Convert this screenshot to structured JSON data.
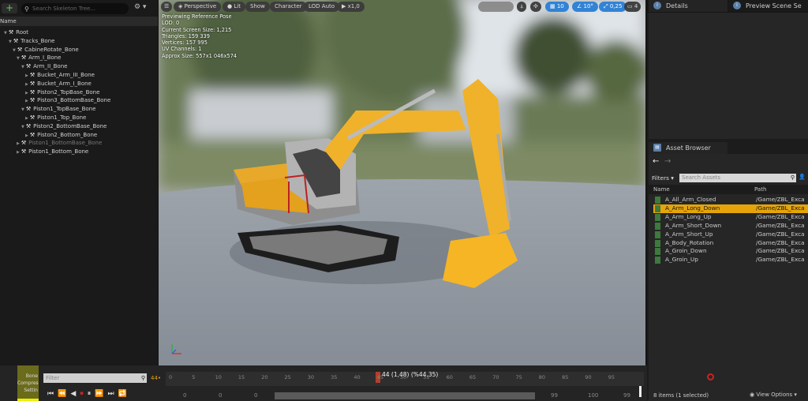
{
  "skeleton_tree": {
    "search_placeholder": "Search Skeleton Tree...",
    "add_label": "+",
    "column_name": "Name",
    "bones": [
      {
        "label": "Root"
      },
      {
        "label": "Tracks_Bone"
      },
      {
        "label": "CabineRotate_Bone"
      },
      {
        "label": "Arm_I_Bone"
      },
      {
        "label": "Arm_II_Bone"
      },
      {
        "label": "Bucket_Arm_III_Bone"
      },
      {
        "label": "Bucket_Arm_I_Bone"
      },
      {
        "label": "Piston2_TopBase_Bone"
      },
      {
        "label": "Piston3_BottomBase_Bone"
      },
      {
        "label": "Piston1_TopBase_Bone"
      },
      {
        "label": "Piston1_Top_Bone"
      },
      {
        "label": "Piston2_BottomBase_Bone"
      },
      {
        "label": "Piston2_Bottom_Bone"
      },
      {
        "label": "Piston1_BottomBase_Bone"
      },
      {
        "label": "Piston1_Bottom_Bone"
      }
    ]
  },
  "viewport": {
    "toolbar": {
      "perspective": "Perspective",
      "lit": "Lit",
      "show": "Show",
      "character": "Character",
      "lod": "LOD Auto",
      "play": "x1,0",
      "grid_snap": "10",
      "rot_snap": "10°",
      "scale_snap": "0,25",
      "camera_speed": "4"
    },
    "stats": [
      "Previewing Reference Pose",
      "LOD: 0",
      "Current Screen Size: 1,215",
      "Triangles: 159 339",
      "Vertices: 157 995",
      "UV Channels: 1",
      "Approx Size: 557x1 046x574"
    ]
  },
  "right_panel": {
    "tabs": [
      {
        "label": "Details"
      },
      {
        "label": "Preview Scene Se"
      }
    ],
    "asset_browser": {
      "tab_label": "Asset Browser",
      "filters_label": "Filters",
      "search_placeholder": "Search Assets",
      "col_name": "Name",
      "col_path": "Path",
      "assets": [
        {
          "name": "A_All_Arm_Closed",
          "path": "/Game/ZBL_Exca"
        },
        {
          "name": "A_Arm_Long_Down",
          "path": "/Game/ZBL_Exca",
          "selected": true
        },
        {
          "name": "A_Arm_Long_Up",
          "path": "/Game/ZBL_Exca"
        },
        {
          "name": "A_Arm_Short_Down",
          "path": "/Game/ZBL_Exca"
        },
        {
          "name": "A_Arm_Short_Up",
          "path": "/Game/ZBL_Exca"
        },
        {
          "name": "A_Body_Rotation",
          "path": "/Game/ZBL_Exca"
        },
        {
          "name": "A_Groin_Down",
          "path": "/Game/ZBL_Exca"
        },
        {
          "name": "A_Groin_Up",
          "path": "/Game/ZBL_Exca"
        }
      ],
      "status": "8 items (1 selected)",
      "view_options": "View Options"
    }
  },
  "timeline": {
    "side_label": "Bone Compres Settin",
    "filter_placeholder": "Filter",
    "frame_label": "44",
    "playhead_label": "44 (1,48) (%44,35)",
    "ticks": [
      "0",
      "5",
      "10",
      "15",
      "20",
      "25",
      "30",
      "35",
      "40",
      "45",
      "50",
      "55",
      "60",
      "65",
      "70",
      "75",
      "80",
      "85",
      "90",
      "95"
    ],
    "range": [
      "0",
      "0",
      "0",
      "99",
      "100",
      "99"
    ],
    "playhead_frame": 44,
    "accent": "#e5a50a"
  }
}
